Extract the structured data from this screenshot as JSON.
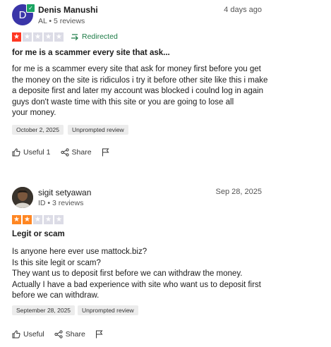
{
  "reviews": [
    {
      "avatar_letter": "D",
      "name": "Denis Manushi",
      "meta": "AL • 5 reviews",
      "date": "4 days ago",
      "rating": 1,
      "redirected": "Redirected",
      "title": "for me is a scammer every site that ask...",
      "body": [
        "for me is a scammer every site that ask for money first before you get",
        "the money on the site is ridiculos i try it before other site like this i make",
        "a deposite first and later my account was blocked i coulnd log in again",
        "guys don't waste time with this site or you are going to lose all",
        "your money."
      ],
      "tags": [
        "October 2, 2025",
        "Unprompted review"
      ],
      "useful": "Useful 1",
      "share": "Share"
    },
    {
      "name": "sigit setyawan",
      "meta": "ID • 3 reviews",
      "date": "Sep 28, 2025",
      "rating": 2,
      "title": "Legit or scam",
      "body": [
        "Is anyone here ever use mattock.biz?",
        "Is this site legit or scam?",
        "They want us to deposit first before we can withdraw the money.",
        "Actually I have a bad experience with site who want us to deposit first",
        "before we can withdraw."
      ],
      "tags": [
        "September 28, 2025",
        "Unprompted review"
      ],
      "useful": "Useful",
      "share": "Share"
    }
  ]
}
